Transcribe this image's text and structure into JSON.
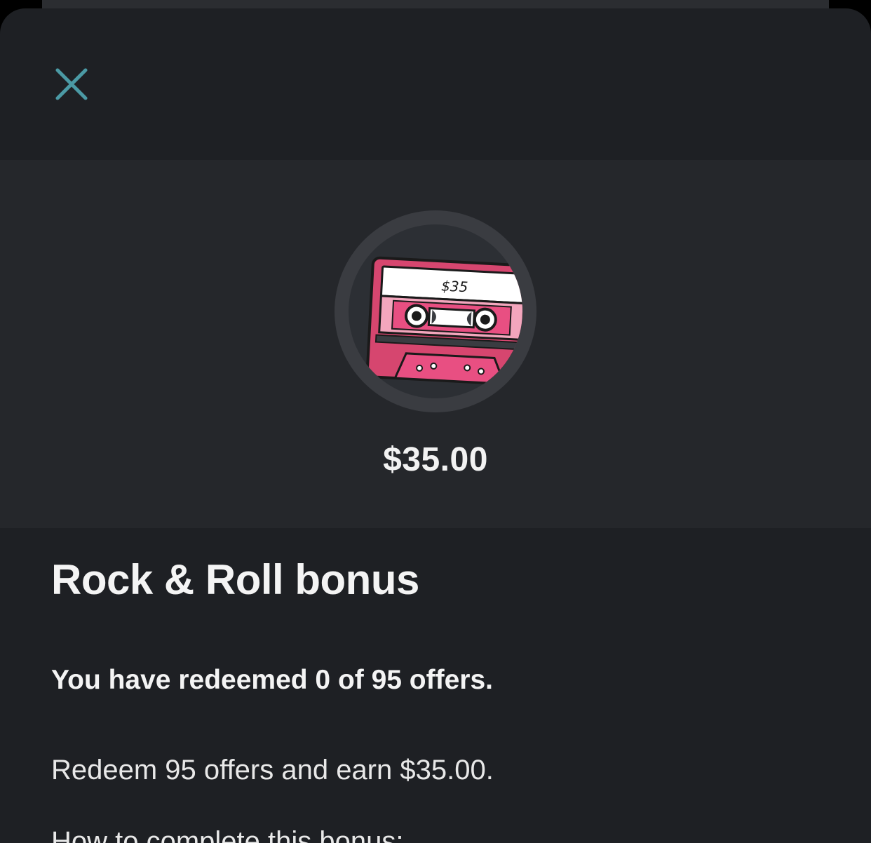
{
  "sheet": {
    "close_icon": "close-icon",
    "close_color": "#4b9aa5"
  },
  "hero": {
    "badge_icon": "cassette-tape-icon",
    "badge_label": "$35",
    "amount": "$35.00"
  },
  "content": {
    "title": "Rock & Roll bonus",
    "status": "You have redeemed 0 of 95 offers.",
    "description": "Redeem 95 offers and earn $35.00.",
    "howto": "How to complete this bonus:"
  }
}
